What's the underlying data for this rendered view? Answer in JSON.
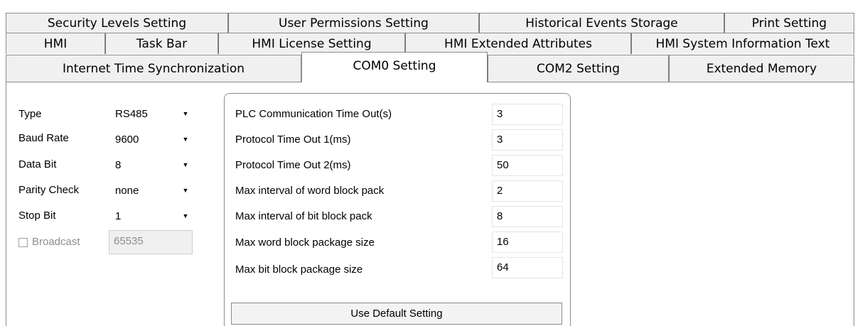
{
  "tabs": {
    "row1": [
      "Security Levels Setting",
      "User Permissions Setting",
      "Historical Events Storage",
      "Print Setting"
    ],
    "row2": [
      "HMI",
      "Task Bar",
      "HMI License Setting",
      "HMI Extended Attributes",
      "HMI System Information Text"
    ],
    "row3": [
      "Internet Time Synchronization",
      "COM0 Setting",
      "COM2 Setting",
      "Extended Memory"
    ],
    "selected": "COM0 Setting"
  },
  "serial": {
    "type_label": "Type",
    "type_value": "RS485",
    "baud_label": "Baud Rate",
    "baud_value": "9600",
    "databit_label": "Data Bit",
    "databit_value": "8",
    "parity_label": "Parity Check",
    "parity_value": "none",
    "stopbit_label": "Stop Bit",
    "stopbit_value": "1",
    "broadcast_label": "Broadcast",
    "broadcast_value": "65535",
    "broadcast_checked": false
  },
  "timing": {
    "rows": [
      {
        "label": "PLC Communication Time Out(s)",
        "value": "3"
      },
      {
        "label": "Protocol Time Out 1(ms)",
        "value": "3"
      },
      {
        "label": "Protocol Time Out 2(ms)",
        "value": "50"
      },
      {
        "label": "Max interval of word block pack",
        "value": "2"
      },
      {
        "label": "Max interval of bit block pack",
        "value": "8"
      },
      {
        "label": "Max word block package size",
        "value": "16"
      },
      {
        "label": "Max bit block package size",
        "value": "64"
      }
    ],
    "default_button": "Use Default Setting"
  },
  "icons": {
    "dropdown": "dropdown-arrow-icon",
    "checkbox": "checkbox-icon"
  }
}
